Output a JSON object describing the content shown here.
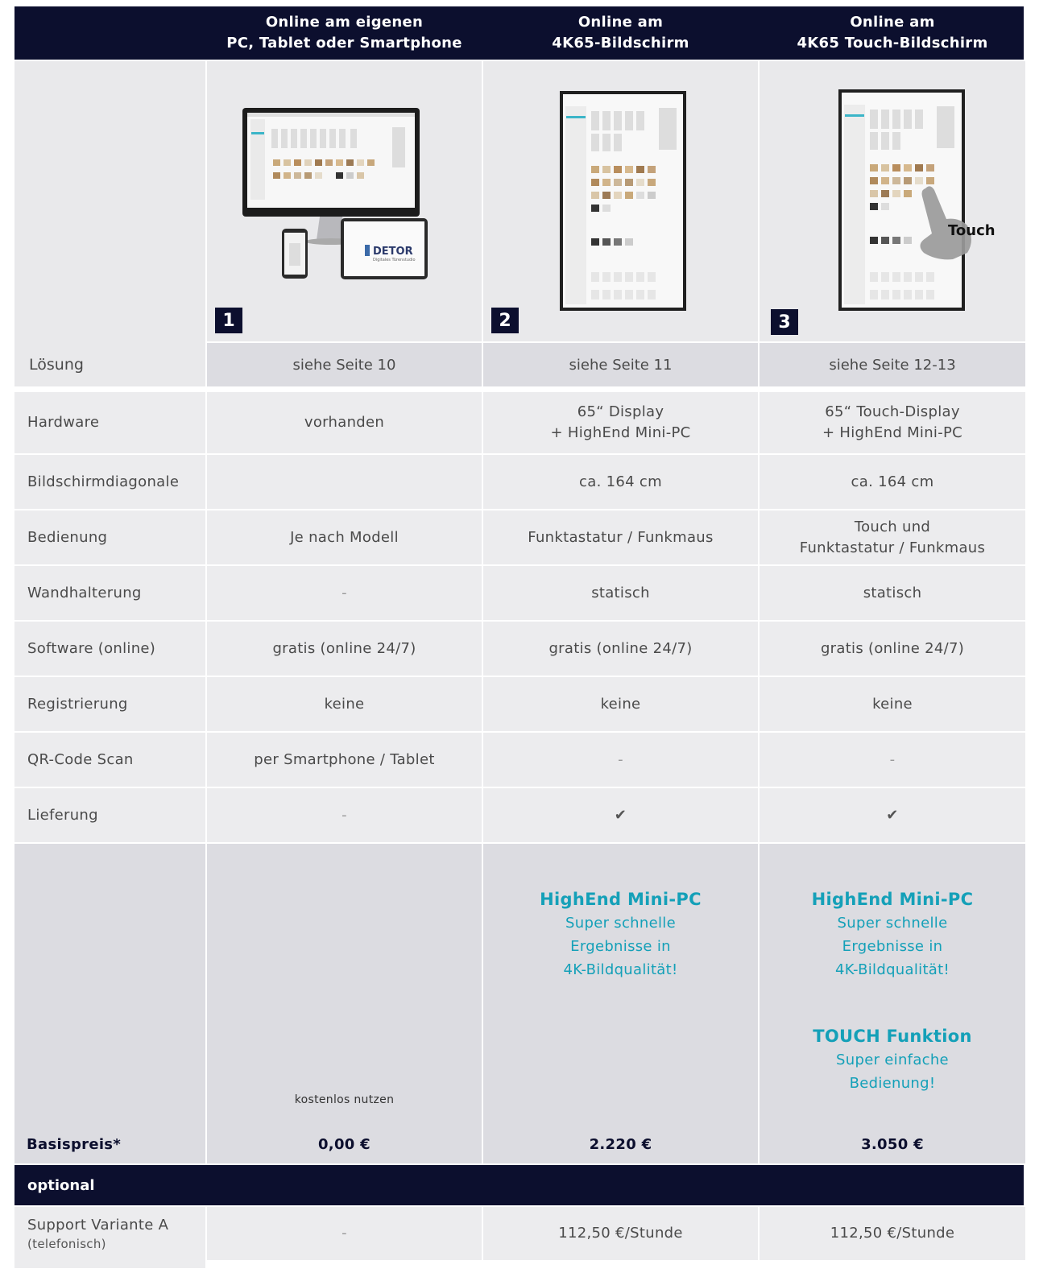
{
  "header": {
    "col1_line1": "Online am eigenen",
    "col1_line2": "PC, Tablet oder Smartphone",
    "col2_line1": "Online am",
    "col2_line2": "4K65-Bildschirm",
    "col3_line1": "Online am",
    "col3_line2": "4K65 Touch-Bildschirm"
  },
  "solution": {
    "label": "Lösung",
    "numbers": [
      "1",
      "2",
      "3"
    ],
    "refs": [
      "siehe Seite 10",
      "siehe Seite 11",
      "siehe Seite 12-13"
    ],
    "touch_label": "Touch",
    "logo_text": "DETOR",
    "logo_sub": "Digitales Türenstudio"
  },
  "rows": [
    {
      "label": "Hardware",
      "c1": "vorhanden",
      "c2a": "65“ Display",
      "c2b": "+ HighEnd Mini-PC",
      "c3a": "65“ Touch-Display",
      "c3b": "+ HighEnd Mini-PC"
    },
    {
      "label": "Bildschirmdiagonale",
      "c1": "",
      "c2": "ca. 164 cm",
      "c3": "ca. 164 cm"
    },
    {
      "label": "Bedienung",
      "c1": "Je nach Modell",
      "c2": "Funktastatur / Funkmaus",
      "c3a": "Touch und",
      "c3b": "Funktastatur / Funkmaus"
    },
    {
      "label": "Wandhalterung",
      "c1": "-",
      "c2": "statisch",
      "c3": "statisch"
    },
    {
      "label": "Software (online)",
      "c1": "gratis (online 24/7)",
      "c2": "gratis (online 24/7)",
      "c3": "gratis (online 24/7)"
    },
    {
      "label": "Registrierung",
      "c1": "keine",
      "c2": "keine",
      "c3": "keine"
    },
    {
      "label": "QR-Code Scan",
      "c1": "per Smartphone / Tablet",
      "c2": "-",
      "c3": "-"
    },
    {
      "label": "Lieferung",
      "c1": "-",
      "c2": "✔",
      "c3": "✔"
    }
  ],
  "price": {
    "label": "Basispreis*",
    "c1_note": "kostenlos nutzen",
    "c1": "0,00 €",
    "c2": "2.220 €",
    "c3": "3.050 €",
    "feature1_title": "HighEnd Mini-PC",
    "feature1_l1": "Super schnelle",
    "feature1_l2": "Ergebnisse in",
    "feature1_l3": "4K-Bildqualität!",
    "feature2_title": "TOUCH Funktion",
    "feature2_l1": "Super einfache",
    "feature2_l2": "Bedienung!"
  },
  "optional": {
    "label": "optional",
    "support_label": "Support Variante A",
    "support_sub": "(telefonisch)",
    "c1": "-",
    "c2": "112,50 €/Stunde",
    "c3": "112,50 €/Stunde"
  },
  "colors": {
    "navy": "#0c0f2e",
    "teal": "#14a0b8",
    "cell": "#ececee",
    "cell_dark": "#dcdce1"
  }
}
